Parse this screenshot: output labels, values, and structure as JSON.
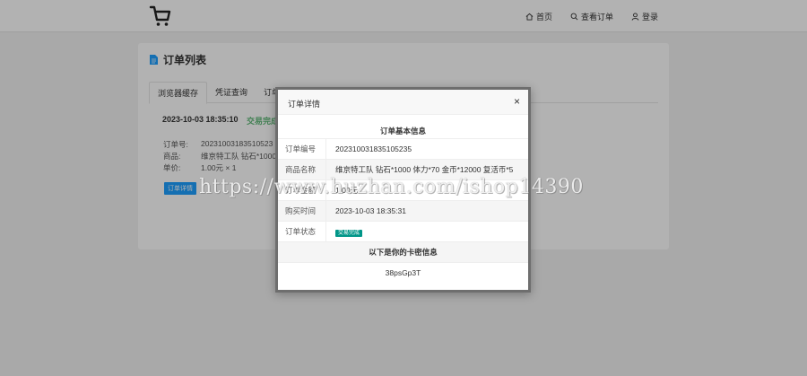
{
  "nav": {
    "home": "首页",
    "view_orders": "查看订单",
    "login": "登录"
  },
  "card": {
    "title": "订单列表",
    "tabs": [
      "浏览器缓存",
      "凭证查询",
      "订单号"
    ],
    "order_time": "2023-10-03 18:35:10",
    "order_status": "交易完成",
    "rows": [
      {
        "k": "订单号:",
        "v": "20231003183510523"
      },
      {
        "k": "商品:",
        "v": "维京特工队 钻石*1000"
      },
      {
        "k": "单价:",
        "v": "1.00元 × 1"
      }
    ],
    "detail_button": "订单详情"
  },
  "modal": {
    "title": "订单详情",
    "close": "×",
    "section1": "订单基本信息",
    "rows": [
      {
        "k": "订单编号",
        "v": "202310031835105235"
      },
      {
        "k": "商品名称",
        "v": "维京特工队 钻石*1000 体力*70 金币*12000 复活币*5"
      },
      {
        "k": "订单金额",
        "v": "1.00元"
      },
      {
        "k": "购买时间",
        "v": "2023-10-03 18:35:31"
      },
      {
        "k": "订单状态",
        "v": "交易完成"
      }
    ],
    "section2": "以下是你的卡密信息",
    "card_code": "38psGp3T"
  },
  "watermark": "https://www.huzhan.com/ishop14390",
  "colors": {
    "accent": "#1e9fff",
    "success": "#5fb878",
    "badge": "#009688"
  }
}
